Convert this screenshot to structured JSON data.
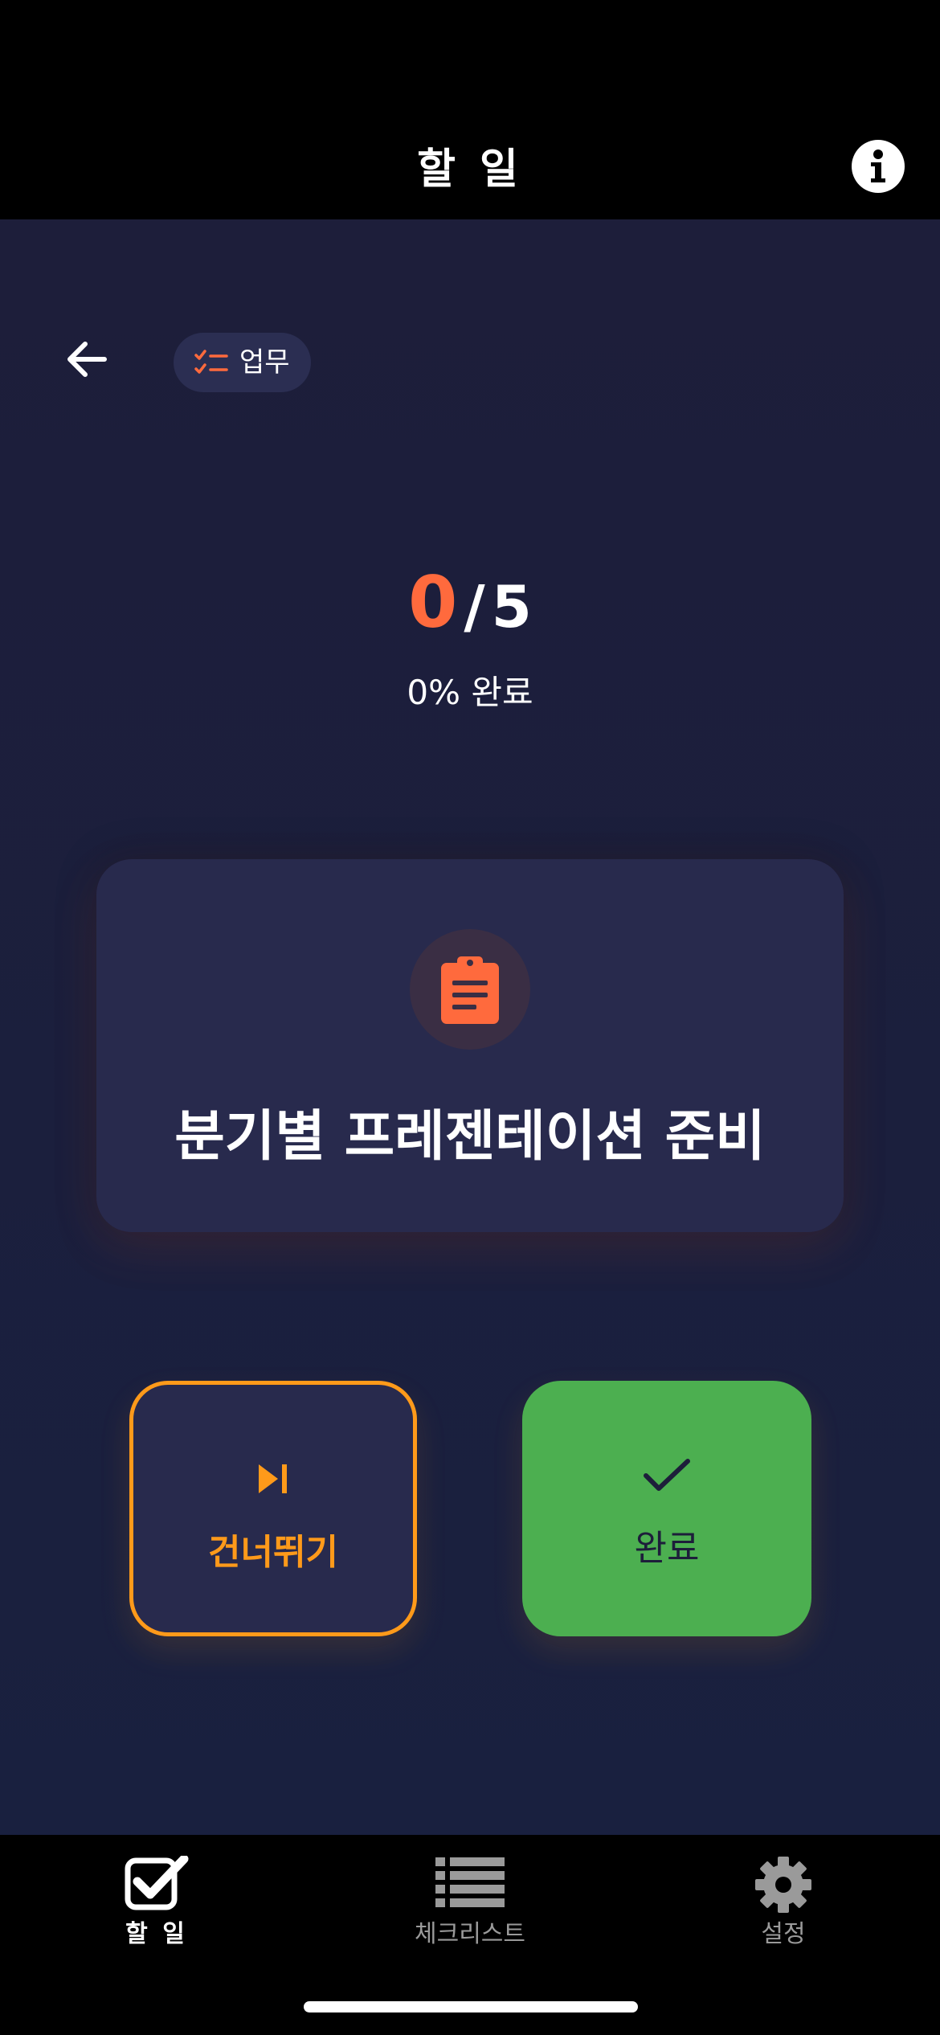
{
  "header": {
    "title": "할 일"
  },
  "category": {
    "label": "업무",
    "icon": "checklist-icon",
    "accent_color": "#ff6a3d"
  },
  "progress": {
    "completed": "0",
    "separator": "/",
    "total": "5",
    "label": "0% 완료",
    "completed_color": "#ff6a3d"
  },
  "task": {
    "icon": "clipboard-icon",
    "title": "분기별 프레젠테이션 준비"
  },
  "actions": {
    "skip_label": "건너뛰기",
    "skip_color": "#ff9a1a",
    "done_label": "완료",
    "done_color": "#4caf50"
  },
  "tabs": [
    {
      "label": "할 일",
      "icon": "checkbox-icon",
      "active": true
    },
    {
      "label": "체크리스트",
      "icon": "list-icon",
      "active": false
    },
    {
      "label": "설정",
      "icon": "gear-icon",
      "active": false
    }
  ]
}
